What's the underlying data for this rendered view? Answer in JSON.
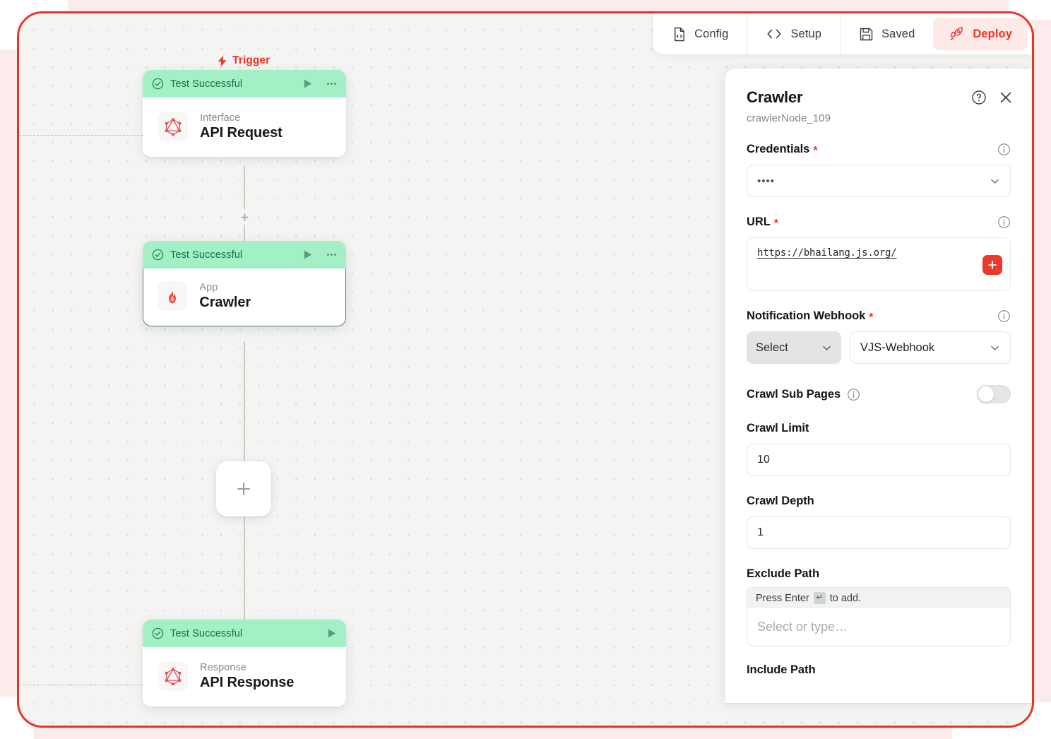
{
  "toolbar": {
    "buttons": [
      {
        "label": "Config",
        "icon": "file-code-icon"
      },
      {
        "label": "Setup",
        "icon": "code-brackets-icon"
      },
      {
        "label": "Saved",
        "icon": "floppy-disk-icon"
      },
      {
        "label": "Deploy",
        "icon": "rocket-icon"
      }
    ]
  },
  "canvas": {
    "trigger_label": "Trigger",
    "nodes": [
      {
        "status": "Test Successful",
        "kind": "Interface",
        "title": "API Request",
        "icon": "graphql-icon",
        "has_more_menu": true,
        "selected": false
      },
      {
        "status": "Test Successful",
        "kind": "App",
        "title": "Crawler",
        "icon": "crawler-flame-icon",
        "has_more_menu": true,
        "selected": true
      },
      {
        "status": "Test Successful",
        "kind": "Response",
        "title": "API Response",
        "icon": "graphql-icon",
        "has_more_menu": false,
        "selected": false
      }
    ],
    "add_button_label": "+"
  },
  "panel": {
    "title": "Crawler",
    "subtitle": "crawlerNode_109",
    "help_icon": "question-circle-icon",
    "close_icon": "close-icon",
    "fields": {
      "credentials": {
        "label": "Credentials",
        "required": "*",
        "value": "••••"
      },
      "url": {
        "label": "URL",
        "required": "*",
        "value": "https://bhailang.js.org/",
        "add_label": "+"
      },
      "webhook": {
        "label": "Notification Webhook",
        "required": "*",
        "select_value": "Select",
        "main_value": "VJS-Webhook"
      },
      "crawl_sub_pages": {
        "label": "Crawl Sub Pages",
        "enabled": false
      },
      "crawl_limit": {
        "label": "Crawl Limit",
        "value": "10"
      },
      "crawl_depth": {
        "label": "Crawl Depth",
        "value": "1"
      },
      "exclude_path": {
        "label": "Exclude Path",
        "hint_prefix": "Press Enter",
        "hint_key": "↵",
        "hint_suffix": "to add.",
        "placeholder": "Select or type…"
      },
      "include_path": {
        "label": "Include Path"
      }
    }
  },
  "colors": {
    "accent_red": "#ef3124",
    "status_green": "#a4f0c6",
    "status_green_text": "#1e6b44",
    "canvas_bg": "#f4f4f2"
  }
}
